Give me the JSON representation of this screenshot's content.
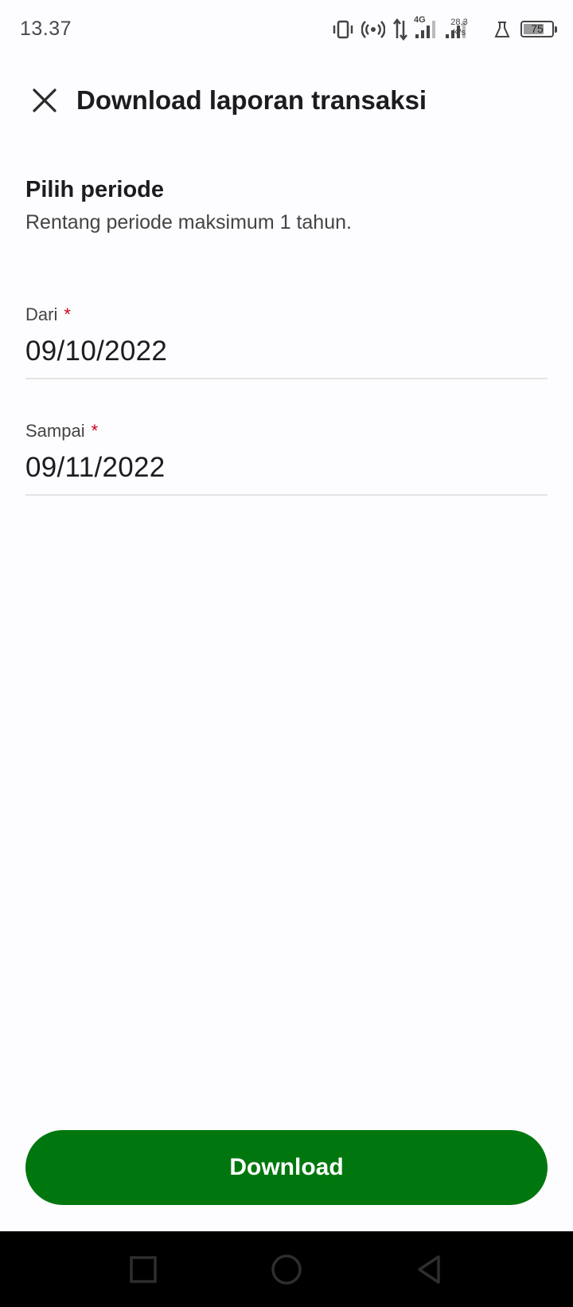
{
  "status_bar": {
    "time": "13.37",
    "network_type": "4G",
    "net_speed_value": "28,3",
    "net_speed_unit": "K/s",
    "battery_level": "75",
    "battery_fraction": 0.75,
    "icons": [
      "vibrate-icon",
      "hotspot-icon",
      "data-transfer-icon",
      "signal-4g-icon",
      "signal-icon",
      "flask-icon",
      "battery-icon"
    ]
  },
  "header": {
    "close_icon": "close-icon",
    "title": "Download laporan transaksi"
  },
  "period": {
    "title": "Pilih periode",
    "subtitle": "Rentang periode maksimum 1 tahun."
  },
  "form": {
    "from_label": "Dari",
    "from_value": "09/10/2022",
    "to_label": "Sampai",
    "to_value": "09/11/2022",
    "required_mark": "*"
  },
  "actions": {
    "download_label": "Download"
  },
  "nav_bar": {
    "icons": [
      "recent-apps-icon",
      "home-icon",
      "back-icon"
    ]
  },
  "colors": {
    "primary": "#00770e",
    "required": "#d0021b",
    "background": "#fdfcfe"
  }
}
